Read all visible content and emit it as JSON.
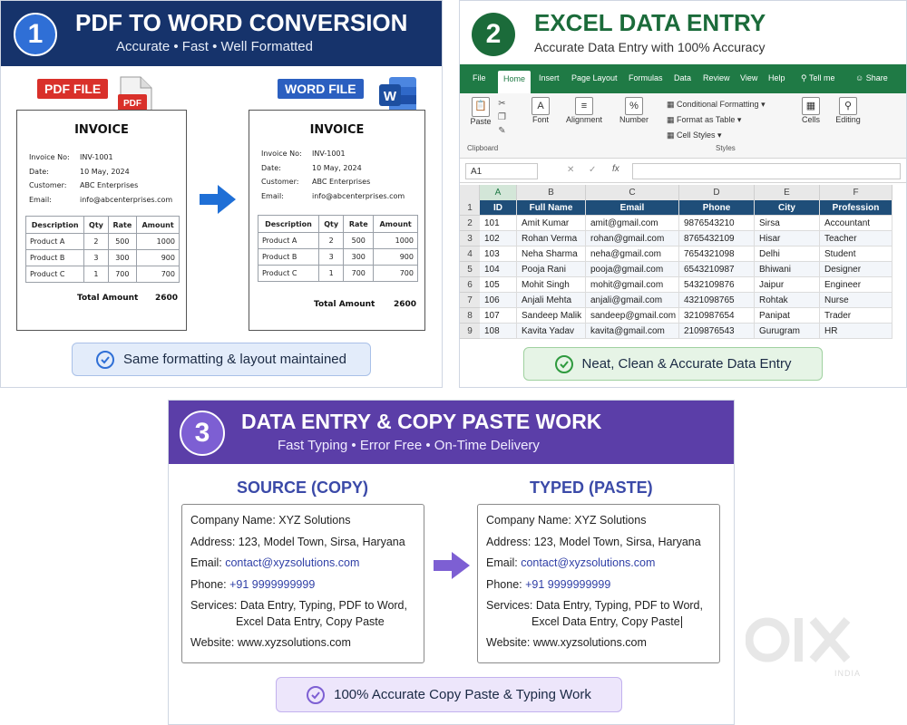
{
  "panel1": {
    "number": "1",
    "title": "PDF TO WORD CONVERSION",
    "subtitle": "Accurate • Fast • Well Formatted",
    "pdf_tag": "PDF FILE",
    "word_tag": "WORD FILE",
    "pdf_icon_text": "PDF",
    "word_icon_text": "W",
    "invoice": {
      "title": "INVOICE",
      "meta": [
        {
          "k": "Invoice No:",
          "v": "INV-1001"
        },
        {
          "k": "Date:",
          "v": "10 May, 2024"
        },
        {
          "k": "Customer:",
          "v": "ABC Enterprises"
        },
        {
          "k": "Email:",
          "v": "info@abcenterprises.com"
        }
      ],
      "headers": [
        "Description",
        "Qty",
        "Rate",
        "Amount"
      ],
      "rows": [
        [
          "Product A",
          "2",
          "500",
          "1000"
        ],
        [
          "Product B",
          "3",
          "300",
          "900"
        ],
        [
          "Product C",
          "1",
          "700",
          "700"
        ]
      ],
      "total_label": "Total Amount",
      "total_value": "2600"
    },
    "footer": "Same formatting & layout maintained",
    "colors": {
      "banner": "#16336b",
      "pdf": "#d9302a",
      "word": "#2b5fc0"
    }
  },
  "panel2": {
    "number": "2",
    "title": "EXCEL DATA ENTRY",
    "subtitle": "Accurate Data Entry with 100% Accuracy",
    "tabs": [
      "File",
      "Home",
      "Insert",
      "Page Layout",
      "Formulas",
      "Data",
      "Review",
      "View",
      "Help",
      "Tell me",
      "Share"
    ],
    "ribbon": {
      "paste": "Paste",
      "clipboard": "Clipboard",
      "font": "Font",
      "alignment": "Alignment",
      "number": "Number",
      "conditional": "Conditional Formatting",
      "format_table": "Format as Table",
      "cell_styles": "Cell Styles",
      "styles": "Styles",
      "cells": "Cells",
      "editing": "Editing"
    },
    "namebox": "A1",
    "fx": "fx",
    "columns": [
      "A",
      "B",
      "C",
      "D",
      "E",
      "F"
    ],
    "headers": [
      "ID",
      "Full Name",
      "Email",
      "Phone",
      "City",
      "Profession"
    ],
    "rows": [
      [
        "101",
        "Amit Kumar",
        "amit@gmail.com",
        "9876543210",
        "Sirsa",
        "Accountant"
      ],
      [
        "102",
        "Rohan Verma",
        "rohan@gmail.com",
        "8765432109",
        "Hisar",
        "Teacher"
      ],
      [
        "103",
        "Neha Sharma",
        "neha@gmail.com",
        "7654321098",
        "Delhi",
        "Student"
      ],
      [
        "104",
        "Pooja Rani",
        "pooja@gmail.com",
        "6543210987",
        "Bhiwani",
        "Designer"
      ],
      [
        "105",
        "Mohit Singh",
        "mohit@gmail.com",
        "5432109876",
        "Jaipur",
        "Engineer"
      ],
      [
        "106",
        "Anjali Mehta",
        "anjali@gmail.com",
        "4321098765",
        "Rohtak",
        "Nurse"
      ],
      [
        "107",
        "Sandeep Malik",
        "sandeep@gmail.com",
        "3210987654",
        "Panipat",
        "Trader"
      ],
      [
        "108",
        "Kavita Yadav",
        "kavita@gmail.com",
        "2109876543",
        "Gurugram",
        "HR"
      ]
    ],
    "row_numbers": [
      "1",
      "2",
      "3",
      "4",
      "5",
      "6",
      "7",
      "8",
      "9"
    ],
    "footer": "Neat, Clean & Accurate Data Entry",
    "colors": {
      "title": "#1b6b3a",
      "ribbon": "#1f7a45",
      "header_row": "#1f4e79"
    }
  },
  "panel3": {
    "number": "3",
    "title": "DATA ENTRY & COPY PASTE WORK",
    "subtitle": "Fast Typing • Error Free • On-Time Delivery",
    "source_title": "SOURCE (COPY)",
    "typed_title": "TYPED (PASTE)",
    "card": {
      "company": "Company Name: XYZ Solutions",
      "address": "Address: 123, Model Town, Sirsa, Haryana",
      "email_label": "Email: ",
      "email": "contact@xyzsolutions.com",
      "phone_label": "Phone: ",
      "phone": "+91 9999999999",
      "services_1": "Services: Data Entry, Typing, PDF to Word,",
      "services_2": "Excel Data Entry, Copy Paste",
      "website": "Website: www.xyzsolutions.com"
    },
    "footer": "100% Accurate Copy Paste & Typing Work",
    "colors": {
      "banner": "#5b3ea8",
      "accent": "#7d5fd3"
    }
  },
  "watermark": {
    "logo": "OLX",
    "text": "INDIA"
  }
}
